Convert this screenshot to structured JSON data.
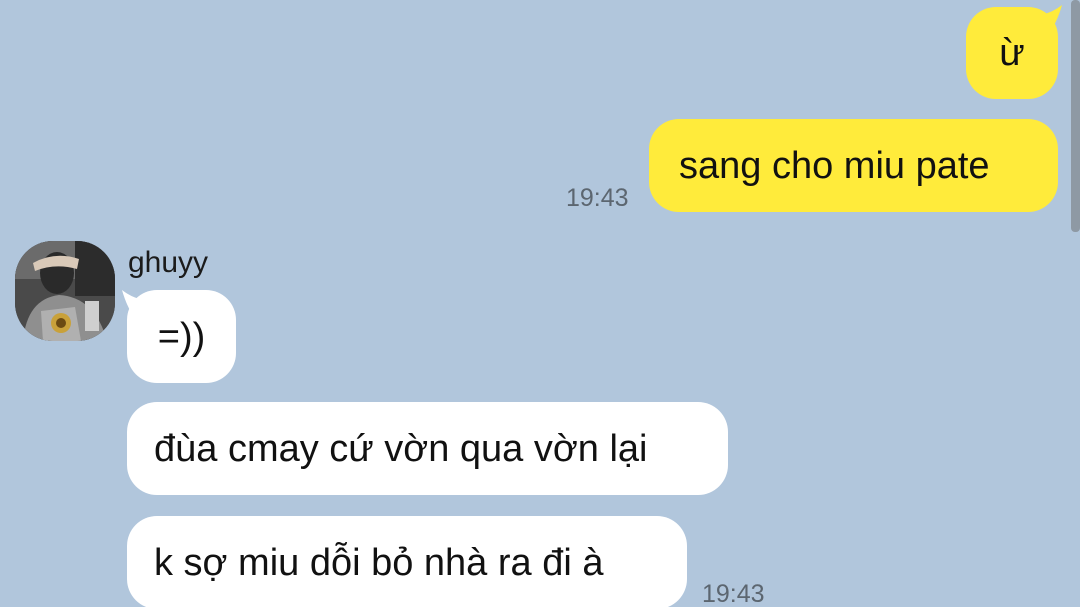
{
  "colors": {
    "background": "#b1c6dc",
    "outgoing_bubble": "#ffeb3b",
    "incoming_bubble": "#ffffff",
    "timestamp": "#5c6670"
  },
  "messages_out": [
    {
      "text": "ừ"
    },
    {
      "text": "sang cho miu pate",
      "time": "19:43"
    }
  ],
  "contact": {
    "name": "ghuyy",
    "avatar_icon": "user-photo-avatar"
  },
  "messages_in": [
    {
      "text": "=))"
    },
    {
      "text": "đùa cmay cứ vờn qua vờn lại"
    },
    {
      "text": "k sợ miu dỗi bỏ nhà ra đi à",
      "time": "19:43"
    }
  ]
}
